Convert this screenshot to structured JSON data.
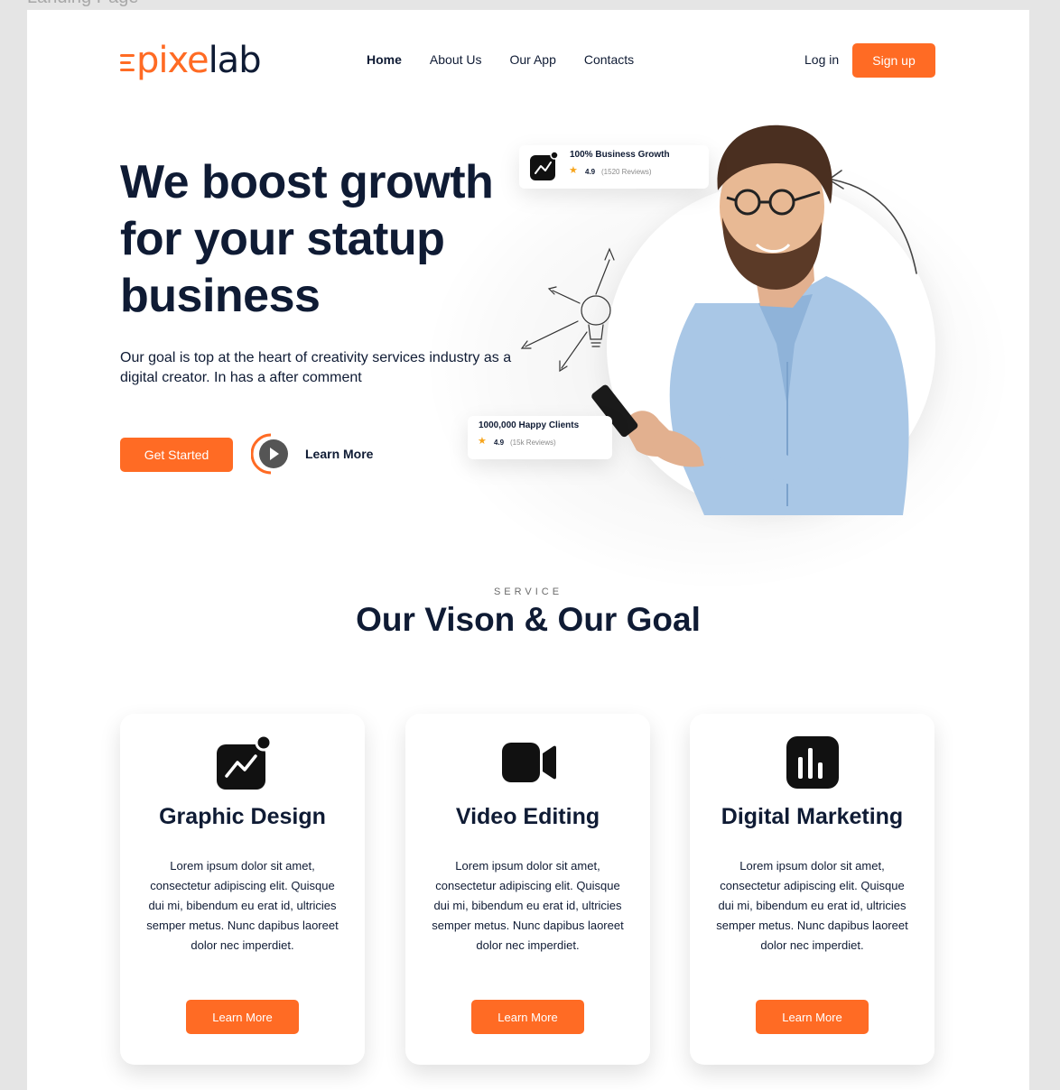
{
  "frame_label": "Landing Page",
  "brand": {
    "logo_part1": "pixe",
    "logo_part2": "lab",
    "accent": "#ff6b24",
    "dark": "#0f1b34"
  },
  "nav": {
    "items": [
      {
        "label": "Home",
        "active": true
      },
      {
        "label": "About Us"
      },
      {
        "label": "Our App"
      },
      {
        "label": "Contacts"
      }
    ],
    "login_label": "Log in",
    "signup_label": "Sign up"
  },
  "hero": {
    "title": "We boost growth for your statup business",
    "description": "Our goal is top at the heart of creativity services industry as a digital creator. In has a after comment",
    "cta_label": "Get Started",
    "secondary_label": "Learn More",
    "stat_cards": [
      {
        "title": "100% Business Growth",
        "rating": "4.9",
        "reviews": "(1520 Reviews)",
        "icon": "trend-chart-icon"
      },
      {
        "title": "1000,000 Happy Clients",
        "rating": "4.9",
        "reviews": "(15k Reviews)",
        "icon": "star-icon"
      }
    ]
  },
  "services": {
    "eyebrow": "SERVICE",
    "title": "Our Vison & Our Goal",
    "cards": [
      {
        "title": "Graphic Design",
        "icon": "trend-chart-icon",
        "text": "Lorem ipsum dolor sit amet, consectetur adipiscing elit. Quisque dui mi, bibendum eu erat id, ultricies semper metus. Nunc dapibus laoreet dolor nec imperdiet.",
        "button": "Learn More"
      },
      {
        "title": "Video Editing",
        "icon": "video-camera-icon",
        "text": "Lorem ipsum dolor sit amet, consectetur adipiscing elit. Quisque dui mi, bibendum eu erat id, ultricies semper metus. Nunc dapibus laoreet dolor nec imperdiet.",
        "button": "Learn More"
      },
      {
        "title": "Digital Marketing",
        "icon": "bar-chart-icon",
        "text": "Lorem ipsum dolor sit amet, consectetur adipiscing elit. Quisque dui mi, bibendum eu erat id, ultricies semper metus. Nunc dapibus laoreet dolor nec imperdiet.",
        "button": "Learn More"
      }
    ]
  }
}
